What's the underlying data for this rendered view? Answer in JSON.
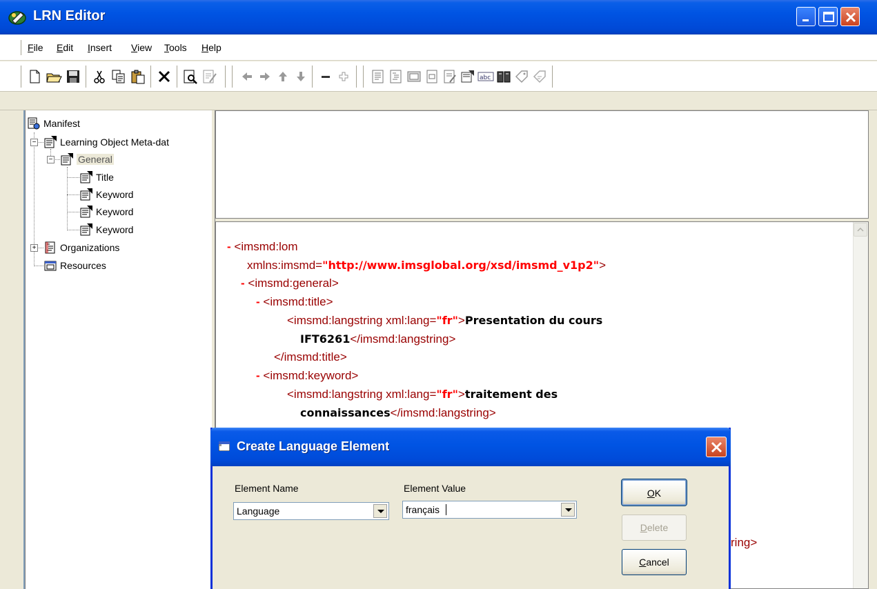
{
  "window": {
    "title": "LRN Editor"
  },
  "menu": [
    {
      "label": "File",
      "key": "F",
      "rest": "ile"
    },
    {
      "label": "Edit",
      "key": "E",
      "rest": "dit"
    },
    {
      "label": "Insert",
      "key": "I",
      "rest": "nsert"
    },
    {
      "label": "View",
      "key": "V",
      "rest": "iew"
    },
    {
      "label": "Tools",
      "key": "T",
      "rest": "ools"
    },
    {
      "label": "Help",
      "key": "H",
      "rest": "elp"
    }
  ],
  "toolbar": {
    "buttons": [
      "new-icon",
      "open-icon",
      "save-icon",
      "cut-icon",
      "copy-icon",
      "paste-icon",
      "delete-icon",
      "preview-icon",
      "validate-icon",
      "arrow-left-icon",
      "arrow-right-icon",
      "arrow-up-icon",
      "arrow-down-icon",
      "collapse-icon",
      "expand-icon",
      "metadata-icon",
      "organization-icon",
      "resource-icon",
      "item-icon",
      "properties-icon",
      "settings-icon",
      "spellcheck-icon",
      "book-icon",
      "tag-icon",
      "package-icon"
    ]
  },
  "tree": {
    "manifest": "Manifest",
    "lom": "Learning Object Meta-dat",
    "general": "General",
    "title": "Title",
    "keyword1": "Keyword",
    "keyword2": "Keyword",
    "keyword3": "Keyword",
    "organizations": "Organizations",
    "resources": "Resources"
  },
  "xml": {
    "minus": "-",
    "lom_open": "<imsmd:lom",
    "xmlns_attr": "xmlns:imsmd=",
    "xmlns_val": "\"http://www.imsglobal.org/xsd/imsmd_v1p2\"",
    "gt": ">",
    "general_open": "<imsmd:general>",
    "title_open": "<imsmd:title>",
    "langstring_open": "<imsmd:langstring",
    "lang_attr": " xml:lang=",
    "lang_val": "\"fr\"",
    "title_text_1": "Presentation du cours",
    "title_text_2": "IFT6261",
    "langstring_close": "</imsmd:langstring>",
    "title_close": "</imsmd:title>",
    "keyword_open": "<imsmd:keyword>",
    "keyword_text_1": "traitement des",
    "keyword_text_2": "connaissances",
    "partial_close": "ring>"
  },
  "dialog": {
    "title": "Create Language Element",
    "element_name_label": "Element Name",
    "element_value_label": "Element Value",
    "element_name_value": "Language",
    "element_value_value": "français",
    "ok_key": "O",
    "ok_rest": "K",
    "delete_key": "D",
    "delete_rest": "elete",
    "cancel_key": "C",
    "cancel_rest": "ancel"
  }
}
